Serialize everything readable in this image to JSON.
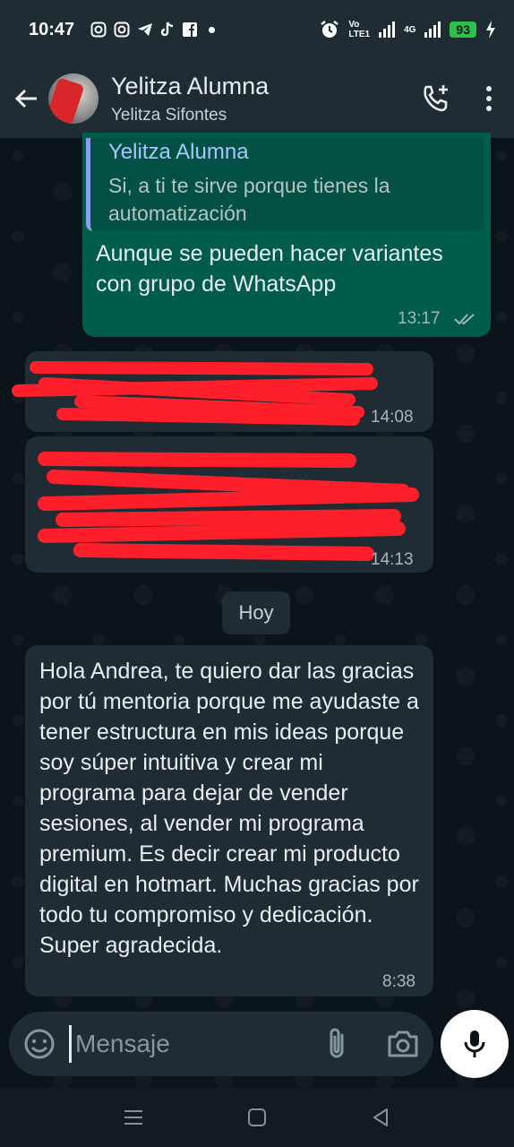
{
  "status_bar": {
    "time": "10:47",
    "network_top": "Vo",
    "network_bottom": "LTE1",
    "network_top2": "4G",
    "battery": "93"
  },
  "header": {
    "title": "Yelitza Alumna",
    "subtitle": "Yelitza Sifontes"
  },
  "messages": {
    "m1": {
      "quote_author": "Yelitza Alumna",
      "quote_text": "Si, a ti te sirve porque tienes la automatización",
      "text": "Aunque se pueden hacer variantes con grupo de WhatsApp",
      "time": "13:17",
      "status": "read"
    },
    "m2": {
      "time": "14:08"
    },
    "m3": {
      "time": "14:13"
    },
    "day_separator": "Hoy",
    "m4": {
      "text": "Hola Andrea, te quiero dar las gracias por tú mentoria porque me ayudaste a tener estructura en mis ideas porque soy súper intuitiva y crear mi programa para dejar de vender sesiones, al vender mi programa premium. Es decir crear mi producto digital en hotmart. Muchas gracias por todo tu compromiso y dedicación. Super agradecida.",
      "time": "8:38"
    }
  },
  "composer": {
    "placeholder": "Mensaje"
  },
  "colors": {
    "outgoing_bubble": "#005c4b",
    "incoming_bubble": "#1f2c34",
    "redaction": "#ff1f2a",
    "background": "#0b141a"
  },
  "icons": [
    "instagram-icon",
    "telegram-icon",
    "tiktok-icon",
    "facebook-icon",
    "alarm-icon",
    "back-arrow-icon",
    "add-call-icon",
    "more-vert-icon",
    "emoji-icon",
    "attach-icon",
    "camera-icon",
    "mic-icon",
    "recents-icon",
    "home-icon",
    "back-icon"
  ]
}
